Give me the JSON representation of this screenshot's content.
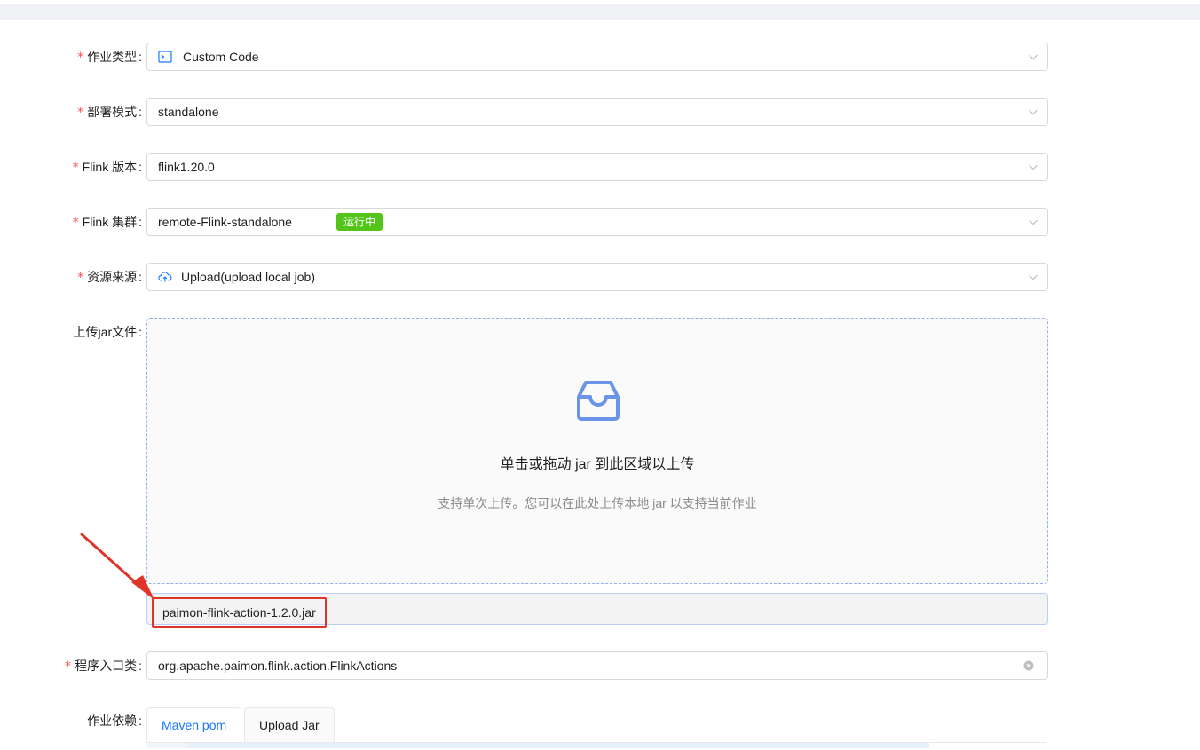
{
  "form": {
    "job_type": {
      "label": "作业类型",
      "value": "Custom Code",
      "icon": "code-terminal-icon"
    },
    "deploy_mode": {
      "label": "部署模式",
      "value": "standalone"
    },
    "flink_version": {
      "label": "Flink 版本",
      "value": "flink1.20.0"
    },
    "flink_cluster": {
      "label": "Flink 集群",
      "value": "remote-Flink-standalone",
      "status": "运行中",
      "status_color": "#52c41a"
    },
    "resource_source": {
      "label": "资源来源",
      "value": "Upload(upload local job)",
      "icon": "cloud-upload-icon"
    },
    "upload": {
      "label": "上传jar文件",
      "title": "单击或拖动 jar 到此区域以上传",
      "hint": "支持单次上传。您可以在此处上传本地 jar 以支持当前作业",
      "icon": "inbox-icon",
      "file_name": "paimon-flink-action-1.2.0.jar"
    },
    "main_class": {
      "label": "程序入口类",
      "value": "org.apache.paimon.flink.action.FlinkActions"
    },
    "dependencies": {
      "label": "作业依赖",
      "tabs": [
        {
          "label": "Maven pom",
          "active": true
        },
        {
          "label": "Upload Jar",
          "active": false
        }
      ]
    }
  },
  "colors": {
    "required": "#ff4d4f",
    "accent": "#1677ff",
    "highlight": "#e0342b"
  }
}
